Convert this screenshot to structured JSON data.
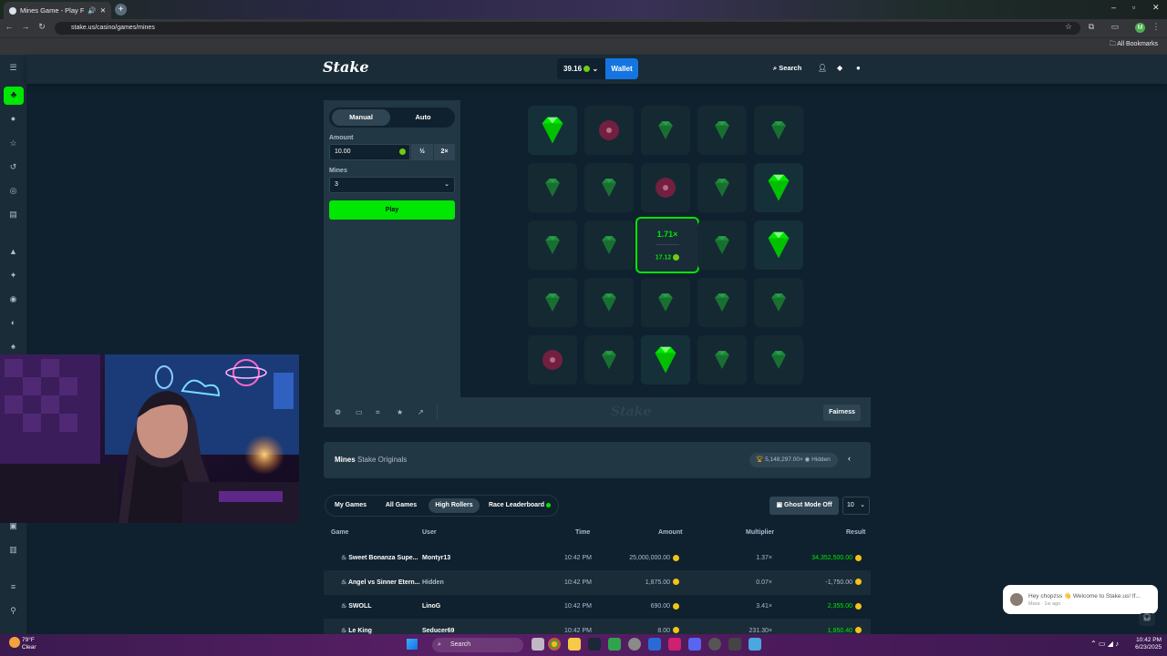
{
  "browser": {
    "tab_title": "Mines Game - Play Free Sc",
    "url": "stake.us/casino/games/mines",
    "bookmarks_label": "All Bookmarks",
    "profile_initial": "M"
  },
  "header": {
    "logo": "Stake",
    "balance": "39.16",
    "wallet_label": "Wallet",
    "search_label": "Search"
  },
  "controls": {
    "mode_manual": "Manual",
    "mode_auto": "Auto",
    "amount_label": "Amount",
    "amount_value": "10.00",
    "half_label": "½",
    "double_label": "2×",
    "mines_label": "Mines",
    "mines_value": "3",
    "play_label": "Play"
  },
  "board": {
    "rows": [
      [
        "gem-revealed",
        "mine",
        "gem",
        "gem",
        "gem"
      ],
      [
        "gem",
        "gem",
        "mine",
        "gem",
        "gem-revealed"
      ],
      [
        "gem",
        "gem",
        "payout",
        "gem",
        "gem-revealed"
      ],
      [
        "gem",
        "gem",
        "gem",
        "gem",
        "gem"
      ],
      [
        "mine",
        "gem",
        "gem-revealed",
        "gem",
        "gem"
      ]
    ],
    "payout_multiplier": "1.71×",
    "payout_amount": "17.12",
    "colors": {
      "gem_bright": "#00e701",
      "gem_dim": "#1f8a3a",
      "mine": "#c0174a",
      "tile": "#152933",
      "accent": "#00e701"
    }
  },
  "game_bar": {
    "watermark": "Stake",
    "fairness_label": "Fairness"
  },
  "info": {
    "title": "Mines",
    "subtitle": "Stake Originals",
    "max_win": "5,148,297.00×",
    "hidden_label": "Hidden"
  },
  "bets": {
    "tabs": [
      "My Games",
      "All Games",
      "High Rollers",
      "Race Leaderboard"
    ],
    "active_tab": "High Rollers",
    "ghost_mode": "Ghost Mode Off",
    "page_size": "10",
    "columns": [
      "Game",
      "User",
      "Time",
      "Amount",
      "Multiplier",
      "Result"
    ],
    "rows": [
      {
        "game": "Sweet Bonanza Supe...",
        "user": "Montyr13",
        "time": "10:42 PM",
        "amount": "25,000,000.00",
        "multiplier": "1.37×",
        "result": "34,352,500.00",
        "win": true
      },
      {
        "game": "Angel vs Sinner Etern...",
        "user": "Hidden",
        "time": "10:42 PM",
        "amount": "1,875.00",
        "multiplier": "0.07×",
        "result": "-1,750.00",
        "win": false
      },
      {
        "game": "SWOLL",
        "user": "LinoG",
        "time": "10:42 PM",
        "amount": "690.00",
        "multiplier": "3.41×",
        "result": "2,355.00",
        "win": true
      },
      {
        "game": "Le King",
        "user": "Seducer69",
        "time": "10:42 PM",
        "amount": "8.00",
        "multiplier": "231.30×",
        "result": "1,850.40",
        "win": true
      }
    ]
  },
  "chat_popup": {
    "message": "Hey chopzss 👋 Welcome to Stake.us! If...",
    "meta": "Mara · 1w ago"
  },
  "taskbar": {
    "weather_temp": "79°F",
    "weather_desc": "Clear",
    "search_label": "Search",
    "time": "10:42 PM",
    "date": "6/23/2025"
  }
}
